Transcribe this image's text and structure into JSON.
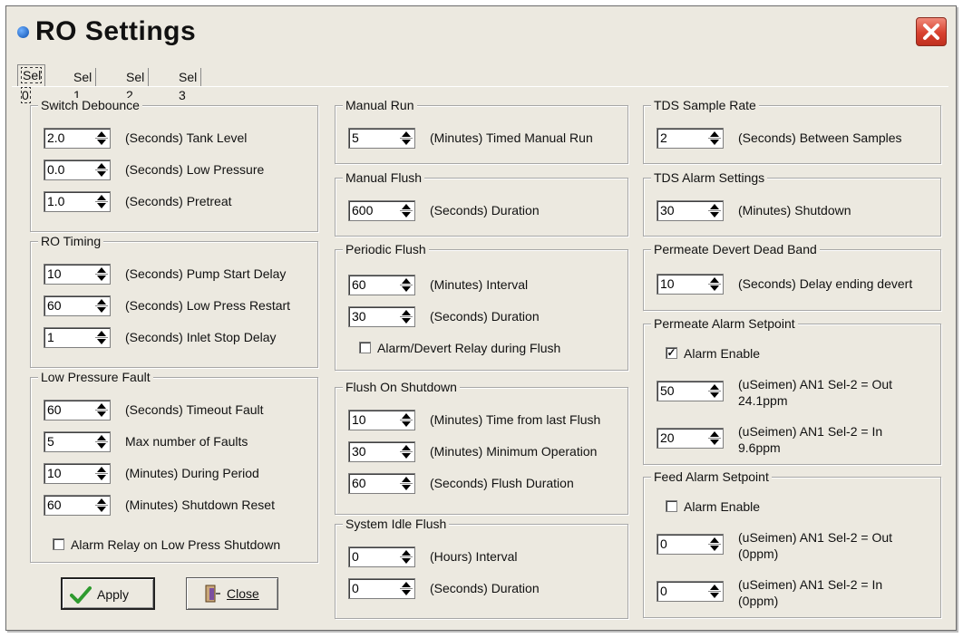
{
  "window": {
    "title": "RO Settings"
  },
  "tabs": [
    "Sel 0",
    "Sel 1",
    "Sel 2",
    "Sel 3"
  ],
  "switch_debounce": {
    "title": "Switch Debounce",
    "rows": [
      {
        "value": "2.0",
        "label": "(Seconds) Tank Level"
      },
      {
        "value": "0.0",
        "label": "(Seconds) Low Pressure"
      },
      {
        "value": "1.0",
        "label": "(Seconds) Pretreat"
      }
    ]
  },
  "ro_timing": {
    "title": "RO Timing",
    "rows": [
      {
        "value": "10",
        "label": "(Seconds) Pump Start Delay"
      },
      {
        "value": "60",
        "label": "(Seconds) Low Press Restart"
      },
      {
        "value": "1",
        "label": "(Seconds) Inlet Stop Delay"
      }
    ]
  },
  "low_pressure_fault": {
    "title": "Low Pressure Fault",
    "rows": [
      {
        "value": "60",
        "label": "(Seconds) Timeout Fault"
      },
      {
        "value": "5",
        "label": "Max number of Faults"
      },
      {
        "value": "10",
        "label": "(Minutes) During Period"
      },
      {
        "value": "60",
        "label": "(Minutes) Shutdown Reset"
      }
    ],
    "checkbox": {
      "label": "Alarm Relay on Low Press Shutdown",
      "checked": false
    }
  },
  "buttons": {
    "apply": "Apply",
    "close": "Close"
  },
  "manual_run": {
    "title": "Manual Run",
    "rows": [
      {
        "value": "5",
        "label": "(Minutes) Timed Manual Run"
      }
    ]
  },
  "manual_flush": {
    "title": "Manual Flush",
    "rows": [
      {
        "value": "600",
        "label": "(Seconds) Duration"
      }
    ]
  },
  "periodic_flush": {
    "title": "Periodic Flush",
    "rows": [
      {
        "value": "60",
        "label": "(Minutes) Interval"
      },
      {
        "value": "30",
        "label": "(Seconds) Duration"
      }
    ],
    "checkbox": {
      "label": "Alarm/Devert Relay during Flush",
      "checked": false
    }
  },
  "flush_on_shutdown": {
    "title": "Flush On Shutdown",
    "rows": [
      {
        "value": "10",
        "label": "(Minutes) Time from last Flush"
      },
      {
        "value": "30",
        "label": "(Minutes) Minimum Operation"
      },
      {
        "value": "60",
        "label": "(Seconds) Flush Duration"
      }
    ]
  },
  "system_idle_flush": {
    "title": "System Idle Flush",
    "rows": [
      {
        "value": "0",
        "label": "(Hours) Interval"
      },
      {
        "value": "0",
        "label": "(Seconds) Duration"
      }
    ]
  },
  "tds_sample_rate": {
    "title": "TDS Sample Rate",
    "rows": [
      {
        "value": "2",
        "label": "(Seconds) Between Samples"
      }
    ]
  },
  "tds_alarm_settings": {
    "title": "TDS Alarm Settings",
    "rows": [
      {
        "value": "30",
        "label": "(Minutes) Shutdown"
      }
    ]
  },
  "permeate_devert": {
    "title": "Permeate Devert Dead Band",
    "rows": [
      {
        "value": "10",
        "label": "(Seconds) Delay ending devert"
      }
    ]
  },
  "permeate_alarm": {
    "title": "Permeate Alarm Setpoint",
    "checkbox": {
      "label": "Alarm Enable",
      "checked": true
    },
    "rows": [
      {
        "value": "50",
        "line1": "(uSeimen) AN1 Sel-2 = Out",
        "line2": "24.1ppm"
      },
      {
        "value": "20",
        "line1": "(uSeimen) AN1 Sel-2 = In",
        "line2": "9.6ppm"
      }
    ]
  },
  "feed_alarm": {
    "title": "Feed Alarm Setpoint",
    "checkbox": {
      "label": "Alarm Enable",
      "checked": false
    },
    "rows": [
      {
        "value": "0",
        "line1": "(uSeimen) AN1 Sel-2 = Out",
        "line2": "(0ppm)"
      },
      {
        "value": "0",
        "line1": "(uSeimen) AN1 Sel-2 = In",
        "line2": "(0ppm)"
      }
    ]
  },
  "colors": {
    "close_button": "#d8412f",
    "dialog_bg": "#ece9e0"
  }
}
